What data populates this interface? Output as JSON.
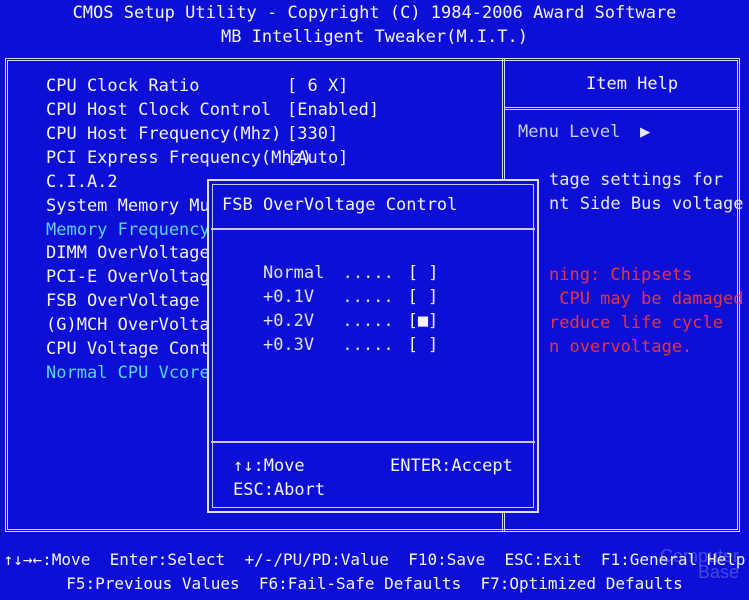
{
  "header": {
    "line1": "CMOS Setup Utility - Copyright (C) 1984-2006 Award Software",
    "line2": "MB Intelligent Tweaker(M.I.T.)"
  },
  "menu": {
    "items": [
      {
        "label": "CPU Clock Ratio",
        "value": "[ 6 X]"
      },
      {
        "label": "CPU Host Clock Control",
        "value": "[Enabled]"
      },
      {
        "label": "CPU Host Frequency(Mhz)",
        "value": "[330]"
      },
      {
        "label": "PCI Express Frequency(Mhz)",
        "value": "[Auto]"
      },
      {
        "label": "C.I.A.2",
        "value": ""
      },
      {
        "label": "System Memory Mul",
        "value": ""
      },
      {
        "label": "Memory Frequency(",
        "value": ""
      },
      {
        "label": "DIMM OverVoltage",
        "value": ""
      },
      {
        "label": "PCI-E OverVoltage",
        "value": ""
      },
      {
        "label": "FSB OverVoltage C",
        "value": ""
      },
      {
        "label": "(G)MCH OverVoltag",
        "value": ""
      },
      {
        "label": "CPU Voltage Contr",
        "value": ""
      },
      {
        "label": "Normal CPU Vcore",
        "value": ""
      }
    ]
  },
  "help": {
    "title": "Item Help",
    "menu_level": "Menu Level",
    "line1": "tage settings for",
    "line2": "nt Side Bus voltage",
    "warn1": "ning: Chipsets",
    "warn2": " CPU may be damaged",
    "warn3": "reduce life cycle",
    "warn4": "n overvoltage."
  },
  "dialog": {
    "title": "FSB OverVoltage Control",
    "options": [
      {
        "label": "Normal",
        "dots": ".....",
        "box": "[ ]"
      },
      {
        "label": "+0.1V",
        "dots": ".....",
        "box": "[ ]"
      },
      {
        "label": "+0.2V",
        "dots": ".....",
        "box": "[■]"
      },
      {
        "label": "+0.3V",
        "dots": ".....",
        "box": "[ ]"
      }
    ],
    "key_move": "↑↓:Move",
    "key_accept": "ENTER:Accept",
    "key_abort": "ESC:Abort"
  },
  "footer": {
    "line1": "↑↓→←:Move  Enter:Select  +/-/PU/PD:Value  F10:Save  ESC:Exit  F1:General Help",
    "line2": "F5:Previous Values  F6:Fail-Safe Defaults  F7:Optimized Defaults"
  },
  "watermark": {
    "line1": "Computer",
    "line2": "Base"
  },
  "colors": {
    "background": "#0d0ed6",
    "text": "#f2f2f6",
    "highlight": "#5ad4ee",
    "warning": "#e8343c"
  }
}
